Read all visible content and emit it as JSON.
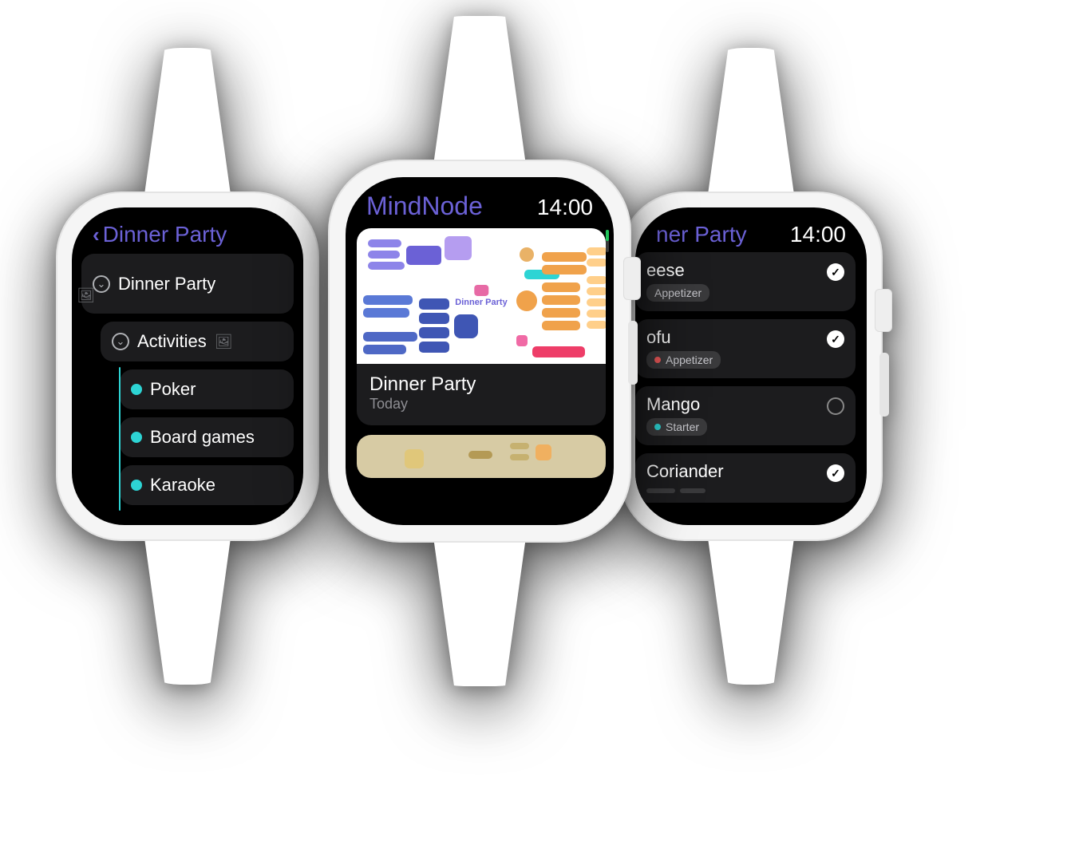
{
  "colors": {
    "accent": "#6b61d6",
    "cyan": "#2dd4d4",
    "orange": "#f0a24b",
    "red": "#f05a5a",
    "green": "#21c45a",
    "grayCard": "#1c1c1e",
    "tagBg": "#3a3a3c"
  },
  "leftWatch": {
    "backTitle": "Dinner Party",
    "rows": [
      {
        "type": "parent",
        "label": "Dinner Party",
        "hasImage": true
      },
      {
        "type": "parent",
        "label": "Activities",
        "hasImage": true,
        "indent": 1
      },
      {
        "type": "leaf",
        "label": "Poker",
        "indent": 2
      },
      {
        "type": "leaf",
        "label": "Board games",
        "indent": 2
      },
      {
        "type": "leaf",
        "label": "Karaoke",
        "indent": 2
      }
    ]
  },
  "centerWatch": {
    "time": "14:00",
    "appTitle": "MindNode",
    "docs": [
      {
        "title": "Dinner Party",
        "subtitle": "Today",
        "thumbCenterLabel": "Dinner Party"
      },
      {
        "title": "",
        "subtitle": ""
      }
    ]
  },
  "rightWatch": {
    "titleSuffix": "ner Party",
    "time": "14:00",
    "tasks": [
      {
        "titleFragment": "eese",
        "checked": true,
        "tags": [
          {
            "label": "Appetizer",
            "dotColor": ""
          }
        ]
      },
      {
        "titleFragment": "ofu",
        "checked": true,
        "tags": [
          {
            "label": "Appetizer",
            "dotColor": "#f05a5a"
          }
        ]
      },
      {
        "titleFragment": "Mango",
        "checked": false,
        "tags": [
          {
            "label": "Starter",
            "dotColor": "#2dd4d4"
          }
        ]
      },
      {
        "titleFragment": "Coriander",
        "checked": true,
        "tags": []
      }
    ]
  }
}
